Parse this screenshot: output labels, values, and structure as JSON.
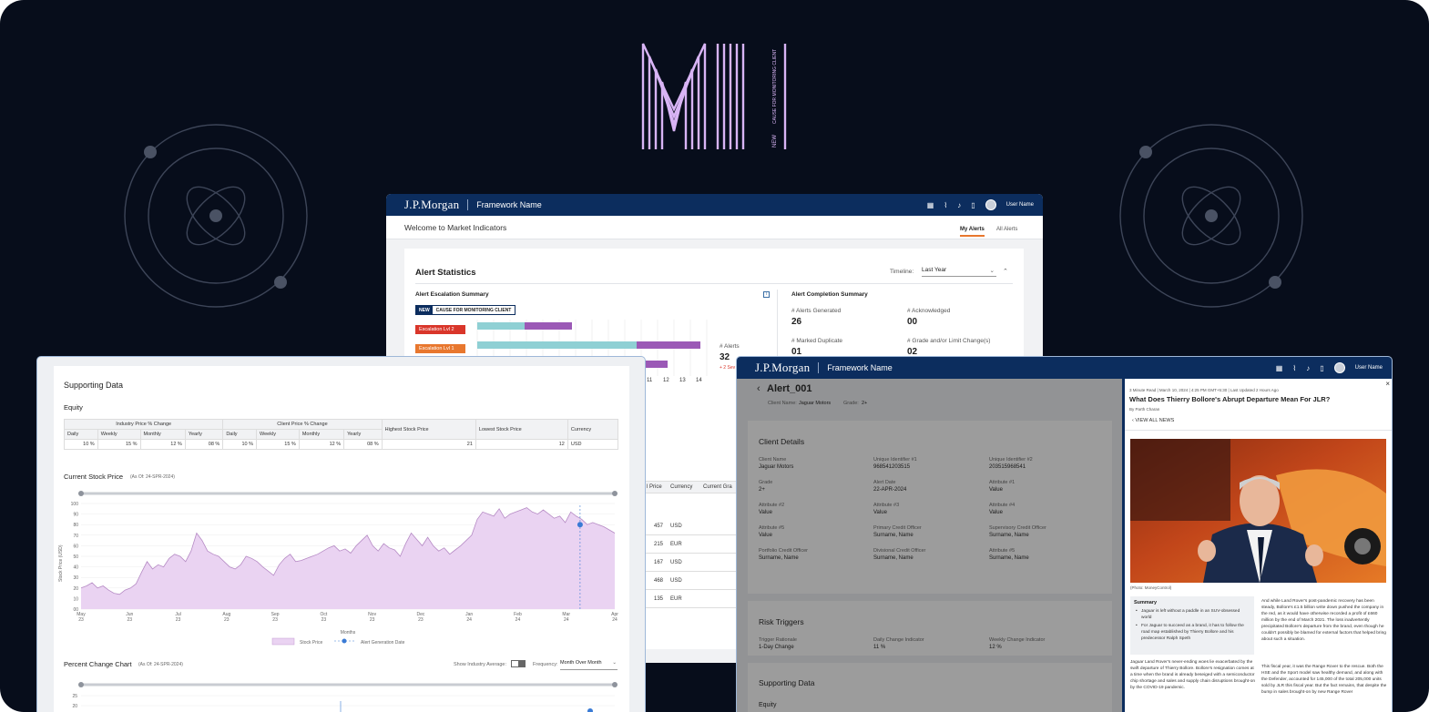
{
  "brand": "J.P.Morgan",
  "framework": "Framework Name",
  "user": "User Name",
  "colors": {
    "navy": "#0c2d5e",
    "purple": "#9b59b6",
    "teal": "#8fd0d4",
    "lilac": "#d9b8f2",
    "red": "#d9362a",
    "orange": "#e8772e"
  },
  "logo": {
    "tag": "NEW",
    "caption": "CAUSE FOR MONITORING CLIENT"
  },
  "market": {
    "welcome": "Welcome to Market Indicators",
    "tabs": [
      "My Alerts",
      "All Alerts"
    ],
    "stats_title": "Alert Statistics",
    "timeline_label": "Timeline:",
    "timeline_value": "Last Year",
    "escalation_title": "Alert Escalation Summary",
    "new_badge": "NEW",
    "cause_label": "CAUSE FOR MONITORING CLIENT",
    "levels": [
      "Escalation Lvl 2",
      "Escalation Lvl 1"
    ],
    "x_ticks": [
      "11",
      "12",
      "13",
      "14"
    ],
    "alerts_label": "# Alerts",
    "alerts_value": "32",
    "alerts_delta": "+ 2 Sev",
    "completion_title": "Alert Completion Summary",
    "completion": [
      {
        "label": "# Alerts Generated",
        "value": "26"
      },
      {
        "label": "# Acknowledged",
        "value": "00"
      },
      {
        "label": "# Marked Duplicate",
        "value": "01"
      },
      {
        "label": "# Grade and/or Limit Change(s)",
        "value": "02"
      }
    ],
    "table_headers": [
      "l Price",
      "Currency",
      "Current Gra"
    ],
    "table_rows": [
      [
        "457",
        "USD"
      ],
      [
        "215",
        "EUR"
      ],
      [
        "167",
        "USD"
      ],
      [
        "468",
        "USD"
      ],
      [
        "135",
        "EUR"
      ]
    ]
  },
  "support": {
    "title": "Supporting Data",
    "equity": "Equity",
    "group1": "Industry Price % Change",
    "group2": "Client Price % Change",
    "sub_cols": [
      "Daily",
      "Weekly",
      "Monthly",
      "Yearly",
      "Daily",
      "Weekly",
      "Monthly",
      "Yearly"
    ],
    "extra_cols": [
      "Highest Stock Price",
      "Lowest Stock Price",
      "Currency"
    ],
    "row": [
      "10 %",
      "15 %",
      "12 %",
      "08 %",
      "10 %",
      "15 %",
      "12 %",
      "08 %",
      "21",
      "12",
      "USD"
    ],
    "stock_title": "Current Stock Price",
    "stock_asof": "(As Of: 24-SPR-2024)",
    "ylabel": "Stock Price (USD)",
    "months_label": "Months",
    "legend_stock": "Stock Price",
    "legend_alert": "Alert Generation Date",
    "pct_title": "Percent Change Chart",
    "pct_asof": "(As Of: 24-SPR-2024)",
    "show_avg": "Show Industry Average:",
    "freq_label": "Frequency:",
    "freq_value": "Month Over Month",
    "pct_ticks": [
      "25",
      "20"
    ]
  },
  "chart_data": {
    "type": "area",
    "title": "Current Stock Price",
    "ylabel": "Stock Price (USD)",
    "xlabel": "Months",
    "ylim": [
      0,
      100
    ],
    "y_ticks": [
      "100",
      "90",
      "80",
      "70",
      "60",
      "50",
      "40",
      "30",
      "20",
      "10",
      "00"
    ],
    "x_ticks": [
      "May 23",
      "Jun 23",
      "Jul 23",
      "Aug 23",
      "Sep 23",
      "Oct 23",
      "Nov 23",
      "Dec 23",
      "Jan 24",
      "Feb 24",
      "Mar 24",
      "Apr 24"
    ],
    "series": [
      {
        "name": "Stock Price",
        "values": [
          20,
          22,
          25,
          20,
          22,
          18,
          15,
          14,
          18,
          20,
          24,
          35,
          45,
          38,
          42,
          40,
          48,
          52,
          50,
          45,
          55,
          72,
          65,
          55,
          52,
          50,
          45,
          40,
          38,
          42,
          50,
          48,
          45,
          40,
          36,
          32,
          42,
          48,
          52,
          45,
          46,
          48,
          50,
          52,
          55,
          58,
          60,
          55,
          57,
          53,
          60,
          65,
          70,
          60,
          55,
          62,
          58,
          56,
          50,
          62,
          72,
          66,
          60,
          68,
          60,
          55,
          58,
          52,
          56,
          60,
          65,
          70,
          85,
          92,
          90,
          88,
          95,
          86,
          90,
          92,
          94,
          96,
          92,
          90,
          94,
          90,
          86,
          88,
          82,
          92,
          88,
          85,
          80,
          82,
          80,
          78,
          75,
          72
        ]
      }
    ],
    "alert_marker": {
      "name": "Alert Generation Date",
      "value": 80
    }
  },
  "alert": {
    "back": "‹",
    "title": "Alert_001",
    "client_label": "Client Name:",
    "client_value": "Jaguar Motors",
    "grade_label": "Grade:",
    "grade_value": "2+",
    "details_title": "Client Details",
    "details": [
      {
        "label": "Client Name",
        "value": "Jaguar Motors"
      },
      {
        "label": "Unique Identifier #1",
        "value": "968541203515"
      },
      {
        "label": "Unique Identifier #2",
        "value": "203515968541"
      },
      {
        "label": "Grade",
        "value": "2+"
      },
      {
        "label": "Alert Date",
        "value": "22-APR-2024"
      },
      {
        "label": "Attribute #1",
        "value": "Value"
      },
      {
        "label": "Attribute #2",
        "value": "Value"
      },
      {
        "label": "Attribute #3",
        "value": "Value"
      },
      {
        "label": "Attribute #4",
        "value": "Value"
      },
      {
        "label": "Attribute #5",
        "value": "Value"
      },
      {
        "label": "Primary Credit Officer",
        "value": "Surname, Name"
      },
      {
        "label": "Supervisory Credit Officer",
        "value": "Surname, Name"
      },
      {
        "label": "Portfolio Credit Officer",
        "value": "Surname, Name"
      },
      {
        "label": "Divisional Credit Officer",
        "value": "Surname, Name"
      },
      {
        "label": "Attribute #5",
        "value": "Surname, Name"
      }
    ],
    "risk_title": "Risk Triggers",
    "risk": [
      {
        "label": "Trigger Rationale",
        "value": "1-Day Change"
      },
      {
        "label": "Daily Change Indicator",
        "value": "11 %"
      },
      {
        "label": "Weekly Change Indicator",
        "value": "12 %"
      }
    ],
    "support_title": "Supporting Data",
    "equity": "Equity"
  },
  "news": {
    "meta": "3 Minute Read | March 10, 2024 | 4:25 PM GMT+5:30 | Last Updated 2 Hours Ago",
    "headline": "What Does Thierry Bollore's Abrupt Departure Mean For JLR?",
    "byline": "By Parth Charan",
    "view_all": "VIEW ALL NEWS",
    "caption": "(Photo: MoneyControl)",
    "summary_title": "Summary",
    "summary": [
      "Jaguar is left without a paddle in an SUV-obsessed world",
      "For Jaguar to succeed as a brand, it has to follow the road map established by Thierry Bollore and his predecessor Ralph Speth"
    ],
    "left_para": "Jaguar Land Rover's never-ending woes lie exacerbated by the swift departure of Thierry Bollore. Bollore's resignation comes at a time when the brand is already beseiged with a semiconductor chip shortage and sales and supply chain disruptions brought-on by the COVID-19 pandemic.",
    "right_para1": "And while Land Rover's post-pandemic recovery has been steady, Bollore's £1.5 billion write down pushed the company in the red, as it would have otherwise recorded a profit of £660 million by the end of March 2021. The loss inadvertently precipitated Bollore's departure from the brand, even though he couldn't possibly be blamed for external factors that helped bring about such a situation.",
    "right_para2": "This fiscal year, it was the Range Rover to the rescue. Both the HSE and the Sport model saw healthy demand, and along with the Defender, accounted for 145,000 of the total 205,000 units sold by JLR this fiscal year. But the fact remains, that despite the bump in sales brought-on by new Range Rover"
  }
}
